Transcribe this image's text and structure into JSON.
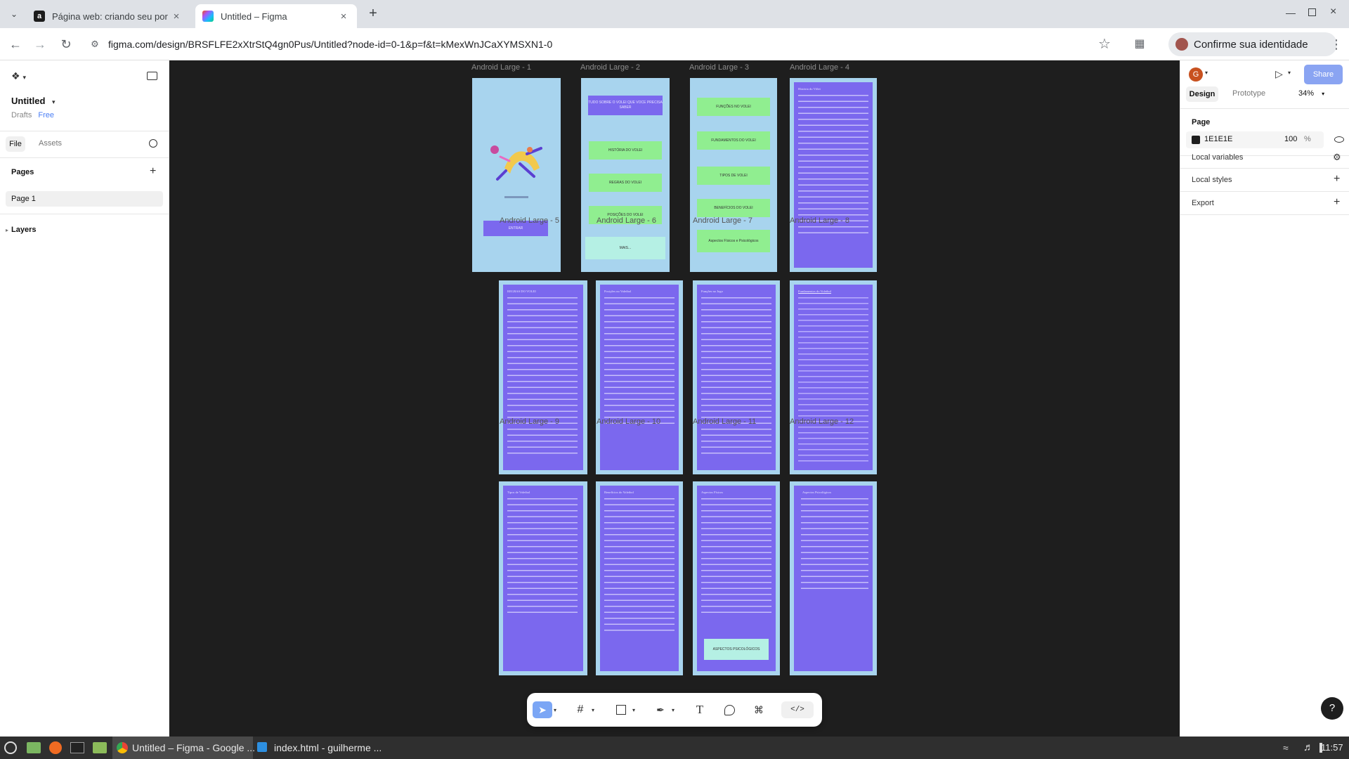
{
  "browser": {
    "tabs": [
      {
        "title": "Página web: criando seu por",
        "icon": "a"
      },
      {
        "title": "Untitled – Figma",
        "icon": "figma"
      }
    ],
    "url": "figma.com/design/BRSFLFE2xXtrStQ4gn0Pus/Untitled?node-id=0-1&p=f&t=kMexWnJCaXYMSXN1-0",
    "identity_label": "Confirme sua identidade"
  },
  "figma": {
    "file_name": "Untitled",
    "drafts_label": "Drafts",
    "plan_label": "Free",
    "tabs": {
      "file": "File",
      "assets": "Assets"
    },
    "pages_heading": "Pages",
    "page_item": "Page 1",
    "layers_heading": "Layers",
    "avatar_letter": "G",
    "share_label": "Share",
    "design_tab": "Design",
    "prototype_tab": "Prototype",
    "zoom": "34%",
    "page_section": "Page",
    "page_color": "1E1E1E",
    "page_opacity": "100",
    "opacity_unit": "%",
    "local_variables": "Local variables",
    "local_styles": "Local styles",
    "export_label": "Export",
    "help_label": "?"
  },
  "canvas": {
    "frames": [
      {
        "label": "Android Large - 1"
      },
      {
        "label": "Android Large - 2"
      },
      {
        "label": "Android Large - 3"
      },
      {
        "label": "Android Large - 4"
      },
      {
        "label": "Android Large - 5"
      },
      {
        "label": "Android Large - 6"
      },
      {
        "label": "Android Large - 7"
      },
      {
        "label": "Android Large - 8"
      },
      {
        "label": "Android Large - 9"
      },
      {
        "label": "Android Large - 10"
      },
      {
        "label": "Android Large - 11"
      },
      {
        "label": "Android Large - 12"
      }
    ],
    "f1_button": "ENTRAR",
    "f2_title": "TUDO SOBRE O VOLEI QUE VOCE PRECISA SABER",
    "f2_buttons": [
      "HISTÓRIA DO VOLEI",
      "REGRAS DO VOLEI",
      "POSIÇÕES DO VOLEI",
      "MAIS..."
    ],
    "f3_buttons": [
      "FUNÇÕES NO VOLEI",
      "FUNDAMENTOS DO VOLEI",
      "TIPOS DE VOLEI",
      "BENEFÍCIOS DO VOLEI",
      "Aspectos Físicos e Psicológicos"
    ],
    "f11_button": "ASPECTOS PSICOLÓGICOS",
    "f4_text": "História do Vôlei",
    "f5_text": "REGRAS DO VOLEI",
    "f6_text": "Posições no Voleibol",
    "f7_text": "Funções no Jogo",
    "f8_text": "Fundamentos do Voleibol",
    "f9_text": "Tipos de Voleibol",
    "f10_text": "Benefícios do Voleibol",
    "f11_text": "Aspectos Físicos",
    "f12_text": "Aspectos Psicológicos"
  },
  "taskbar": {
    "items": [
      "Untitled – Figma - Google ...",
      "index.html - guilherme ..."
    ],
    "clock": "11:57"
  },
  "colors": {
    "canvas_bg": "#1e1e1e",
    "frame_bg": "#a8d4ee",
    "card_purple": "#7b68ee",
    "button_green": "#90ee90",
    "share_blue": "#8aa4f2",
    "selected_tool": "#7ba6f5"
  }
}
